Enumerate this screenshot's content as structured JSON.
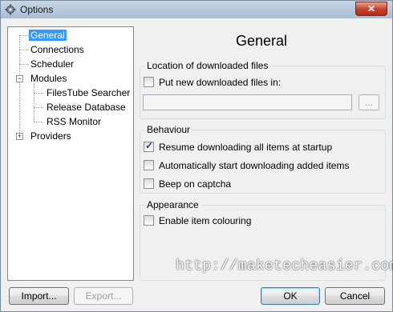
{
  "window": {
    "title": "Options",
    "close_glyph": "✕"
  },
  "tree": {
    "items": [
      {
        "label": "General",
        "selected": true
      },
      {
        "label": "Connections"
      },
      {
        "label": "Scheduler"
      },
      {
        "label": "Modules",
        "expander": "−"
      },
      {
        "label": "FilesTube Searcher"
      },
      {
        "label": "Release Database"
      },
      {
        "label": "RSS Monitor"
      },
      {
        "label": "Providers",
        "expander": "+"
      }
    ]
  },
  "panel": {
    "title": "General",
    "location_group": {
      "label": "Location of downloaded files",
      "put_new_label": "Put new downloaded files in:",
      "put_new_checked": false,
      "path_value": "",
      "browse_label": "..."
    },
    "behaviour_group": {
      "label": "Behaviour",
      "options": [
        {
          "label": "Resume downloading all items at startup",
          "checked": true
        },
        {
          "label": "Automatically start downloading added items",
          "checked": false
        },
        {
          "label": "Beep on captcha",
          "checked": false
        }
      ]
    },
    "appearance_group": {
      "label": "Appearance",
      "options": [
        {
          "label": "Enable item colouring",
          "checked": false
        }
      ]
    }
  },
  "buttons": {
    "import": "Import...",
    "export": "Export...",
    "ok": "OK",
    "cancel": "Cancel"
  },
  "watermark": "http://maketecheasier.com",
  "colors": {
    "selection": "#3399ff",
    "close_button": "#c7452d",
    "window_bg": "#f0f0f0"
  },
  "icons": {
    "title": "gear-icon",
    "checkmark": "checkmark-icon"
  }
}
